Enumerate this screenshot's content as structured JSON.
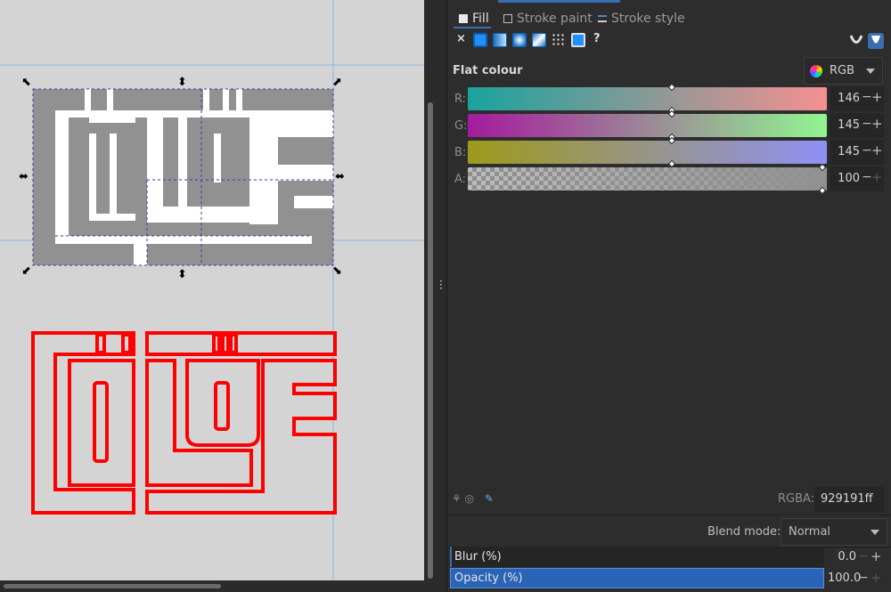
{
  "tabs": [
    {
      "label": "Fill",
      "active": true
    },
    {
      "label": "Stroke paint",
      "active": false
    },
    {
      "label": "Stroke style",
      "active": false
    }
  ],
  "paint_modes": {
    "none_glyph": "×",
    "unknown_glyph": "?",
    "items": [
      "flat-colour",
      "linear-gradient",
      "radial-gradient",
      "mesh-gradient",
      "pattern",
      "swatch"
    ]
  },
  "fill_rules": [
    "evenodd",
    "nonzero"
  ],
  "flat_colour": {
    "title": "Flat colour",
    "mode_label": "RGB"
  },
  "channels": [
    {
      "label": "R:",
      "value": "146",
      "fraction": 0.57,
      "from": "#1aa39e",
      "to": "#f59090"
    },
    {
      "label": "G:",
      "value": "145",
      "fraction": 0.57,
      "from": "#a51a9e",
      "to": "#92f590"
    },
    {
      "label": "B:",
      "value": "145",
      "fraction": 0.57,
      "from": "#9e9a1a",
      "to": "#9090f5"
    },
    {
      "label": "A:",
      "value": "100",
      "fraction": 1.0,
      "from": "transparent",
      "to": "#929191"
    }
  ],
  "rgba": {
    "label": "RGBA:",
    "value": "929191ff"
  },
  "blend": {
    "label": "Blend mode:",
    "value": "Normal"
  },
  "blur": {
    "label": "Blur (%)",
    "value": "0.0",
    "fraction": 0.0
  },
  "opacity": {
    "label": "Opacity (%)",
    "value": "100.0",
    "fraction": 1.0
  },
  "colors": {
    "accent": "#2a64b6",
    "canvas_bg": "#d4d4d4",
    "object_fill": "#929191",
    "outline_stroke": "#ff0000"
  }
}
